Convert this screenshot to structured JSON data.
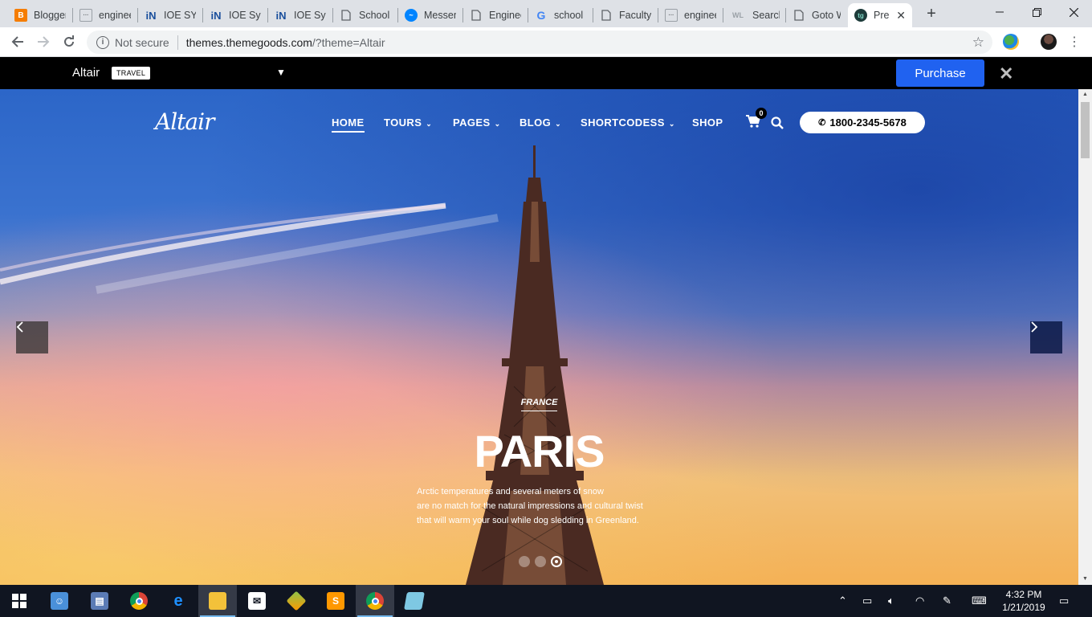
{
  "browser": {
    "tabs": [
      {
        "label": "Blogger",
        "icon": "blogger-icon"
      },
      {
        "label": "enginee",
        "icon": "page-icon"
      },
      {
        "label": "IOE SYL",
        "icon": "in-icon"
      },
      {
        "label": "IOE Syll",
        "icon": "in-icon"
      },
      {
        "label": "IOE Syll",
        "icon": "in-icon"
      },
      {
        "label": "School",
        "icon": "document-icon"
      },
      {
        "label": "Messen",
        "icon": "messenger-icon"
      },
      {
        "label": "Enginee",
        "icon": "document-icon"
      },
      {
        "label": "school",
        "icon": "google-icon"
      },
      {
        "label": "Faculty",
        "icon": "document-icon"
      },
      {
        "label": "enginee",
        "icon": "page-icon"
      },
      {
        "label": "Search",
        "icon": "wl-icon"
      },
      {
        "label": "Goto W",
        "icon": "document-icon"
      },
      {
        "label": "Pre",
        "icon": "themegoods-icon",
        "active": true
      }
    ],
    "security_label": "Not secure",
    "url_host": "themes.themegoods.com",
    "url_path": "/?theme=Altair"
  },
  "demo_bar": {
    "theme_name": "Altair",
    "category_badge": "TRAVEL",
    "purchase_label": "Purchase"
  },
  "site": {
    "logo_text": "Altair",
    "menu": [
      {
        "label": "HOME",
        "active": true,
        "has_dropdown": false
      },
      {
        "label": "TOURS",
        "has_dropdown": true
      },
      {
        "label": "PAGES",
        "has_dropdown": true
      },
      {
        "label": "BLOG",
        "has_dropdown": true
      },
      {
        "label": "SHORTCODESS",
        "has_dropdown": true
      },
      {
        "label": "SHOP",
        "has_dropdown": false
      }
    ],
    "cart_count": "0",
    "phone": "1800-2345-5678"
  },
  "hero": {
    "eyebrow": "FRANCE",
    "headline": "PARIS",
    "description_lines": [
      "Arctic temperatures and several meters of snow",
      "are no match for the natural impressions and cultural twist",
      "that will warm your soul while dog sledding in Greenland."
    ],
    "slides_total": 3,
    "active_slide": 3
  },
  "taskbar": {
    "apps": [
      "start-icon",
      "contacts-icon",
      "file-manager-icon",
      "chrome-icon",
      "edge-icon",
      "file-explorer-icon",
      "mail-icon",
      "layers-icon",
      "sublime-icon",
      "chrome-icon",
      "notes-icon"
    ],
    "time": "4:32 PM",
    "date": "1/21/2019"
  },
  "colors": {
    "purchase_button": "#2062f0",
    "demo_bar": "#000000",
    "taskbar": "#101521"
  }
}
